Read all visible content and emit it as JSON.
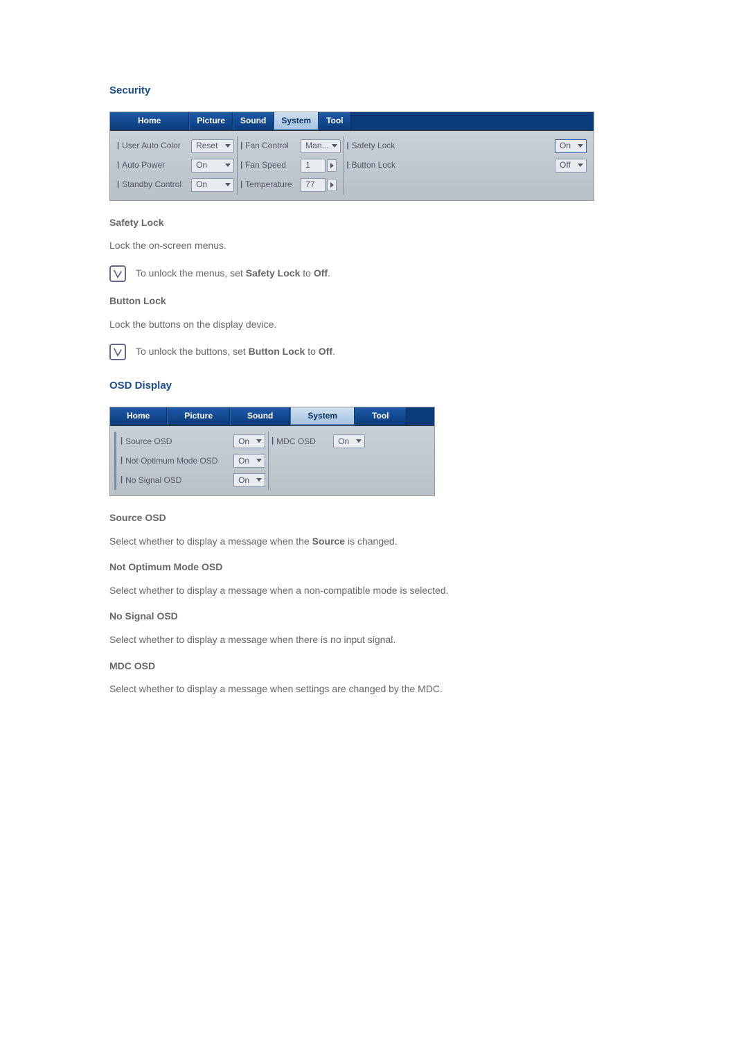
{
  "security": {
    "title": "Security",
    "tabs": [
      "Home",
      "Picture",
      "Sound",
      "System",
      "Tool"
    ],
    "active_tab": 3,
    "col1": {
      "user_auto_color": {
        "label": "User Auto Color",
        "value": "Reset"
      },
      "auto_power": {
        "label": "Auto Power",
        "value": "On"
      },
      "standby_control": {
        "label": "Standby Control",
        "value": "On"
      }
    },
    "col2": {
      "fan_control": {
        "label": "Fan Control",
        "value": "Man..."
      },
      "fan_speed": {
        "label": "Fan Speed",
        "value": "1"
      },
      "temperature": {
        "label": "Temperature",
        "value": "77"
      }
    },
    "col3": {
      "safety_lock": {
        "label": "Safety Lock",
        "value": "On"
      },
      "button_lock": {
        "label": "Button Lock",
        "value": "Off"
      }
    }
  },
  "safety_lock": {
    "title": "Safety Lock",
    "desc": "Lock the on-screen menus.",
    "note_pre": "To unlock the menus, set ",
    "note_bold": "Safety Lock",
    "note_mid": " to ",
    "note_bold2": "Off",
    "note_post": "."
  },
  "button_lock": {
    "title": "Button Lock",
    "desc": "Lock the buttons on the display device.",
    "note_pre": "To unlock the buttons, set ",
    "note_bold": "Button Lock",
    "note_mid": " to ",
    "note_bold2": "Off",
    "note_post": "."
  },
  "osd_display": {
    "title": "OSD Display",
    "tabs": [
      "Home",
      "Picture",
      "Sound",
      "System",
      "Tool"
    ],
    "active_tab": 3,
    "col1": {
      "source_osd": {
        "label": "Source OSD",
        "value": "On"
      },
      "not_optimum": {
        "label": "Not Optimum Mode OSD",
        "value": "On"
      },
      "no_signal": {
        "label": "No Signal OSD",
        "value": "On"
      }
    },
    "col2": {
      "mdc_osd": {
        "label": "MDC OSD",
        "value": "On"
      }
    }
  },
  "source_osd": {
    "title": "Source OSD",
    "desc_pre": "Select whether to display a message when the ",
    "desc_bold": "Source",
    "desc_post": " is changed."
  },
  "not_optimum": {
    "title": "Not Optimum Mode OSD",
    "desc": "Select whether to display a message when a non-compatible mode is selected."
  },
  "no_signal": {
    "title": "No Signal OSD",
    "desc": "Select whether to display a message when there is no input signal."
  },
  "mdc_osd": {
    "title": "MDC OSD",
    "desc": "Select whether to display a message when settings are changed by the MDC."
  }
}
